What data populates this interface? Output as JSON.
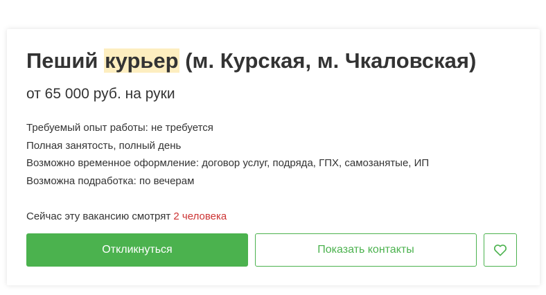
{
  "vacancy": {
    "title_before": "Пеший ",
    "title_highlight": "курьер",
    "title_after": " (м. Курская, м. Чкаловская)",
    "salary": "от 65 000 руб. на руки",
    "details": [
      "Требуемый опыт работы: не требуется",
      "Полная занятость, полный день",
      "Возможно временное оформление: договор услуг, подряда, ГПХ, самозанятые, ИП",
      "Возможна подработка: по вечерам"
    ],
    "viewers_prefix": "Сейчас эту вакансию смотрят ",
    "viewers_count": "2 человека"
  },
  "actions": {
    "respond_label": "Откликнуться",
    "contacts_label": "Показать контакты",
    "favorite_icon": "heart-icon"
  },
  "colors": {
    "accent_green": "#4bb24e",
    "highlight": "#fdeec0",
    "viewers_count": "#cc3333",
    "text": "#333333"
  }
}
